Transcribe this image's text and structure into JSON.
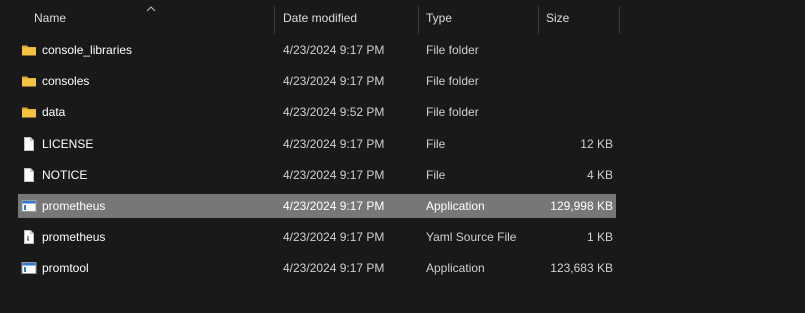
{
  "columns": {
    "name": "Name",
    "date_modified": "Date modified",
    "type": "Type",
    "size": "Size"
  },
  "files": [
    {
      "name": "console_libraries",
      "date": "4/23/2024 9:17 PM",
      "type": "File folder",
      "size": "",
      "icon": "folder-icon"
    },
    {
      "name": "consoles",
      "date": "4/23/2024 9:17 PM",
      "type": "File folder",
      "size": "",
      "icon": "folder-icon"
    },
    {
      "name": "data",
      "date": "4/23/2024 9:52 PM",
      "type": "File folder",
      "size": "",
      "icon": "folder-icon"
    },
    {
      "name": "LICENSE",
      "date": "4/23/2024 9:17 PM",
      "type": "File",
      "size": "12 KB",
      "icon": "file-icon"
    },
    {
      "name": "NOTICE",
      "date": "4/23/2024 9:17 PM",
      "type": "File",
      "size": "4 KB",
      "icon": "file-icon"
    },
    {
      "name": "prometheus",
      "date": "4/23/2024 9:17 PM",
      "type": "Application",
      "size": "129,998 KB",
      "icon": "application-icon",
      "selected": true
    },
    {
      "name": "prometheus",
      "date": "4/23/2024 9:17 PM",
      "type": "Yaml Source File",
      "size": "1 KB",
      "icon": "yaml-file-icon"
    },
    {
      "name": "promtool",
      "date": "4/23/2024 9:17 PM",
      "type": "Application",
      "size": "123,683 KB",
      "icon": "application-icon"
    }
  ],
  "colors": {
    "background": "#191919",
    "selected_row": "#777777",
    "folder": "#f5c242",
    "header_text": "#dcdcdc"
  }
}
